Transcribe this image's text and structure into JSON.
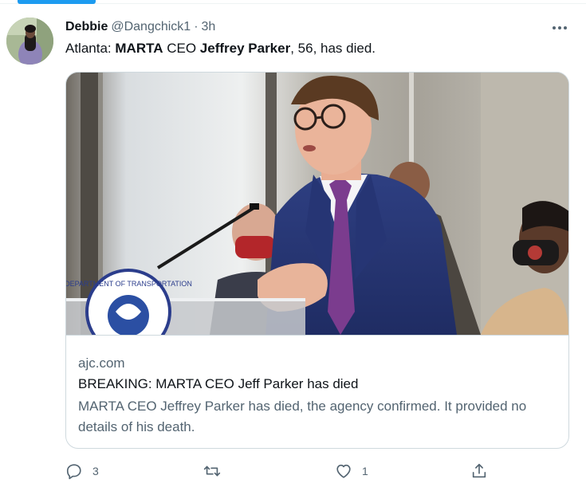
{
  "tweet": {
    "author": {
      "display_name": "Debbie",
      "handle": "@Dangchick1",
      "separator": "·",
      "time": "3h"
    },
    "text": {
      "part1": "Atlanta: ",
      "part2": "MARTA",
      "part3": " CEO ",
      "part4": "Jeffrey Parker",
      "part5": ", 56, has died."
    },
    "card": {
      "domain": "ajc.com",
      "title": "BREAKING: MARTA CEO Jeff Parker has died",
      "description": "MARTA CEO Jeffrey Parker has died, the agency confirmed. It provided no details of his death.",
      "podium_seal_text": "DEPARTMENT OF TRANSPORTATION"
    },
    "actions": {
      "reply_count": "3",
      "retweet_count": "",
      "like_count": "1"
    }
  },
  "icons": {
    "more": "more-horizontal-icon",
    "reply": "reply-icon",
    "retweet": "retweet-icon",
    "like": "heart-icon",
    "share": "share-icon"
  },
  "colors": {
    "accent": "#1d9bf0",
    "text_primary": "#0f1419",
    "text_secondary": "#536471",
    "border": "#cfd9de"
  }
}
